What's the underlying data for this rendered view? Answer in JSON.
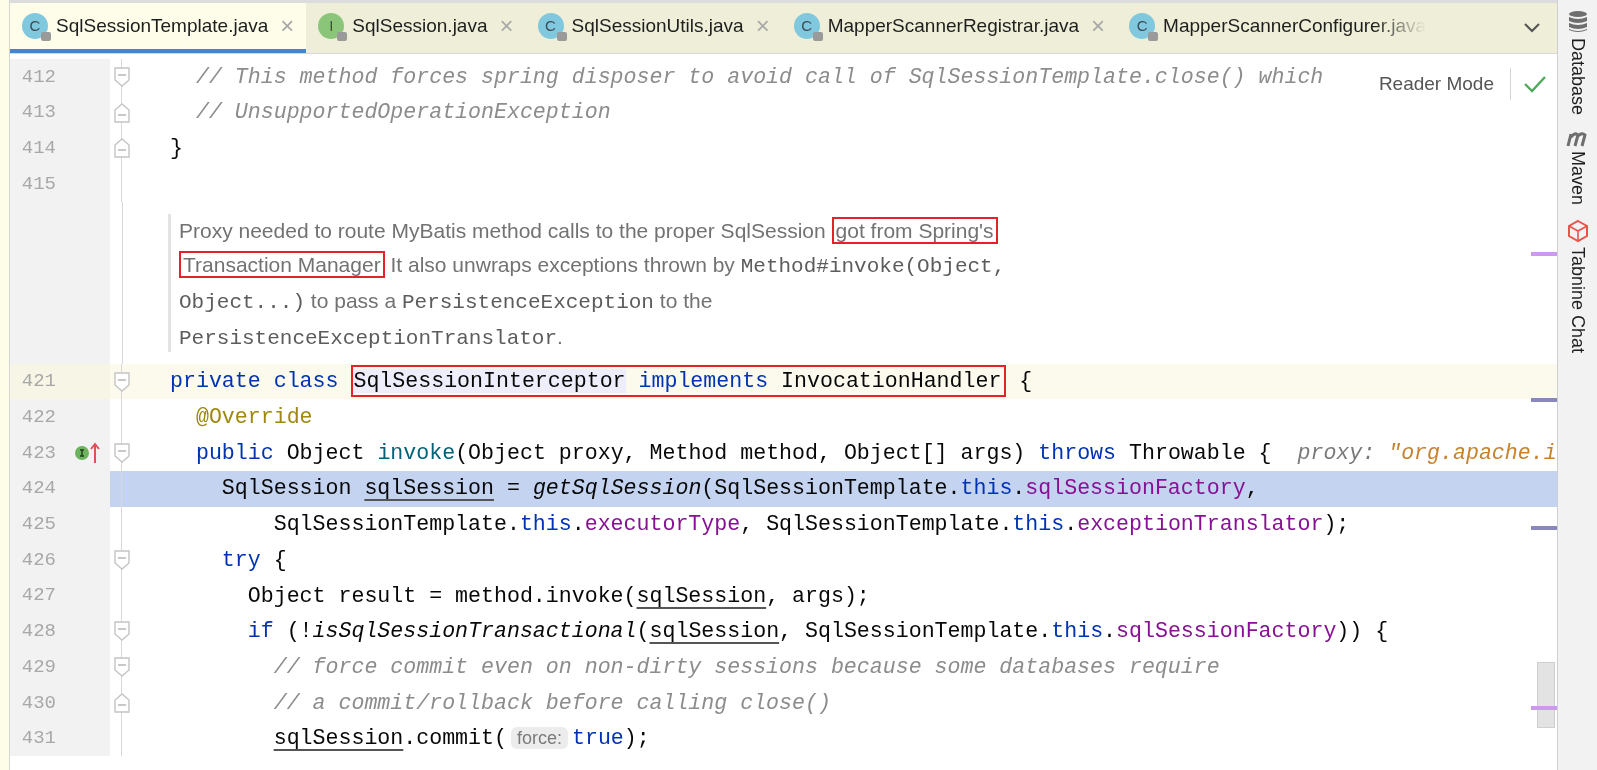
{
  "tabs": [
    {
      "label": "SqlSessionTemplate.java",
      "icon_letter": "C",
      "interface": false,
      "locked": true,
      "close": "×",
      "faded": false,
      "selected": true
    },
    {
      "label": "SqlSession.java",
      "icon_letter": "I",
      "interface": true,
      "locked": true,
      "close": "×",
      "faded": false,
      "selected": false
    },
    {
      "label": "SqlSessionUtils.java",
      "icon_letter": "C",
      "interface": false,
      "locked": true,
      "close": "×",
      "faded": false,
      "selected": false
    },
    {
      "label": "MapperScannerRegistrar.java",
      "icon_letter": "C",
      "interface": false,
      "locked": true,
      "close": "×",
      "faded": false,
      "selected": false
    },
    {
      "label": "MapperScannerConfigurer.java",
      "icon_letter": "C",
      "interface": false,
      "locked": true,
      "faded": true,
      "selected": false
    }
  ],
  "editor": {
    "reader_mode": "Reader Mode",
    "lines": [
      {
        "kind": "code",
        "number": "412",
        "fold_start": true,
        "fold_end": false,
        "implements_marker": false,
        "caret": false,
        "selected": false,
        "tokens": [
          {
            "t": "  // This method forces spring disposer to avoid call of SqlSessionTemplate.close() which",
            "kind": "comment"
          }
        ]
      },
      {
        "kind": "code",
        "number": "413",
        "fold_start": false,
        "fold_end": true,
        "implements_marker": false,
        "caret": false,
        "selected": false,
        "tokens": [
          {
            "t": "  // UnsupportedOperationException",
            "kind": "comment"
          }
        ]
      },
      {
        "kind": "code",
        "number": "414",
        "fold_start": false,
        "fold_end": true,
        "implements_marker": false,
        "caret": false,
        "selected": false,
        "tokens": [
          {
            "t": "}",
            "kind": "plain"
          }
        ]
      },
      {
        "kind": "code",
        "number": "415",
        "fold_start": false,
        "fold_end": false,
        "implements_marker": false,
        "caret": false,
        "selected": false
      },
      {
        "kind": "doc",
        "lines": [
          [
            {
              "t": "Proxy needed to route MyBatis method calls to the proper SqlSession ",
              "kind": "text",
              "box": false
            },
            {
              "t": "got from Spring's",
              "kind": "text",
              "box": true
            }
          ],
          [
            {
              "t": "Transaction Manager",
              "kind": "text",
              "box": true
            },
            {
              "t": " It also unwraps exceptions thrown by ",
              "kind": "text",
              "box": false
            },
            {
              "t": "Method#invoke(Object,",
              "kind": "code",
              "box": false
            }
          ],
          [
            {
              "t": "Object...)",
              "kind": "code",
              "box": false
            },
            {
              "t": " to pass a ",
              "kind": "text",
              "box": false
            },
            {
              "t": "PersistenceException",
              "kind": "code",
              "box": false
            },
            {
              "t": " to the",
              "kind": "text",
              "box": false
            }
          ],
          [
            {
              "t": "PersistenceExceptionTranslator",
              "kind": "code",
              "box": false
            },
            {
              "t": ".",
              "kind": "text",
              "box": false
            }
          ]
        ]
      },
      {
        "kind": "code",
        "number": "421",
        "fold_start": true,
        "fold_end": false,
        "implements_marker": false,
        "caret": true,
        "selected": false,
        "tokens": [
          {
            "t": "private class ",
            "kind": "keyword"
          },
          {
            "box": [
              {
                "t": "SqlSessionInterceptor",
                "kind": "usage"
              },
              {
                "t": " implements",
                "kind": "keyword"
              },
              {
                "t": " InvocationHandler",
                "kind": "plain"
              }
            ]
          },
          {
            "t": " {",
            "kind": "plain"
          }
        ]
      },
      {
        "kind": "code",
        "number": "422",
        "fold_start": false,
        "fold_end": false,
        "implements_marker": false,
        "caret": false,
        "selected": false,
        "tokens": [
          {
            "t": "  @Override",
            "kind": "annotation"
          }
        ]
      },
      {
        "kind": "code",
        "number": "423",
        "fold_start": true,
        "fold_end": false,
        "implements_marker": true,
        "caret": false,
        "selected": false,
        "tokens": [
          {
            "t": "  public",
            "kind": "keyword"
          },
          {
            "t": " Object ",
            "kind": "plain"
          },
          {
            "t": "invoke",
            "kind": "method"
          },
          {
            "t": "(Object proxy, Method method, Object[] args) ",
            "kind": "plain"
          },
          {
            "t": "throws",
            "kind": "keyword"
          },
          {
            "t": " Throwable {  ",
            "kind": "plain"
          },
          {
            "t": "proxy: ",
            "kind": "hint"
          },
          {
            "t": "\"org.apache.i",
            "kind": "string"
          }
        ]
      },
      {
        "kind": "code",
        "number": "424",
        "fold_start": false,
        "fold_end": false,
        "implements_marker": false,
        "caret": false,
        "selected": true,
        "tokens": [
          {
            "t": "    SqlSession ",
            "kind": "plain"
          },
          {
            "t": "sqlSession",
            "kind": "variable"
          },
          {
            "t": " = ",
            "kind": "plain"
          },
          {
            "t": "getSqlSession",
            "kind": "static"
          },
          {
            "t": "(SqlSessionTemplate.",
            "kind": "plain"
          },
          {
            "t": "this",
            "kind": "keyword"
          },
          {
            "t": ".",
            "kind": "plain"
          },
          {
            "t": "sqlSessionFactory",
            "kind": "field"
          },
          {
            "t": ",",
            "kind": "plain"
          }
        ]
      },
      {
        "kind": "code",
        "number": "425",
        "fold_start": false,
        "fold_end": false,
        "implements_marker": false,
        "caret": false,
        "selected": false,
        "tokens": [
          {
            "t": "        SqlSessionTemplate.",
            "kind": "plain"
          },
          {
            "t": "this",
            "kind": "keyword"
          },
          {
            "t": ".",
            "kind": "plain"
          },
          {
            "t": "executorType",
            "kind": "field"
          },
          {
            "t": ", SqlSessionTemplate.",
            "kind": "plain"
          },
          {
            "t": "this",
            "kind": "keyword"
          },
          {
            "t": ".",
            "kind": "plain"
          },
          {
            "t": "exceptionTranslator",
            "kind": "field"
          },
          {
            "t": ");",
            "kind": "plain"
          }
        ]
      },
      {
        "kind": "code",
        "number": "426",
        "fold_start": true,
        "fold_end": false,
        "implements_marker": false,
        "caret": false,
        "selected": false,
        "tokens": [
          {
            "t": "    try",
            "kind": "keyword"
          },
          {
            "t": " {",
            "kind": "plain"
          }
        ]
      },
      {
        "kind": "code",
        "number": "427",
        "fold_start": false,
        "fold_end": false,
        "implements_marker": false,
        "caret": false,
        "selected": false,
        "tokens": [
          {
            "t": "      Object result = method.invoke(",
            "kind": "plain"
          },
          {
            "t": "sqlSession",
            "kind": "variable"
          },
          {
            "t": ", args);",
            "kind": "plain"
          }
        ]
      },
      {
        "kind": "code",
        "number": "428",
        "fold_start": true,
        "fold_end": false,
        "implements_marker": false,
        "caret": false,
        "selected": false,
        "tokens": [
          {
            "t": "      if",
            "kind": "keyword"
          },
          {
            "t": " (!",
            "kind": "plain"
          },
          {
            "t": "isSqlSessionTransactional",
            "kind": "static"
          },
          {
            "t": "(",
            "kind": "plain"
          },
          {
            "t": "sqlSession",
            "kind": "variable"
          },
          {
            "t": ", SqlSessionTemplate.",
            "kind": "plain"
          },
          {
            "t": "this",
            "kind": "keyword"
          },
          {
            "t": ".",
            "kind": "plain"
          },
          {
            "t": "sqlSessionFactory",
            "kind": "field"
          },
          {
            "t": ")) {",
            "kind": "plain"
          }
        ]
      },
      {
        "kind": "code",
        "number": "429",
        "fold_start": true,
        "fold_end": false,
        "implements_marker": false,
        "caret": false,
        "selected": false,
        "tokens": [
          {
            "t": "        // force commit even on non-dirty sessions because some databases require",
            "kind": "comment"
          }
        ]
      },
      {
        "kind": "code",
        "number": "430",
        "fold_start": false,
        "fold_end": true,
        "implements_marker": false,
        "caret": false,
        "selected": false,
        "tokens": [
          {
            "t": "        // a commit/rollback before calling close()",
            "kind": "comment"
          }
        ]
      },
      {
        "kind": "code",
        "number": "431",
        "fold_start": false,
        "fold_end": false,
        "implements_marker": false,
        "caret": false,
        "selected": false,
        "tokens": [
          {
            "t": "        sqlSession",
            "kind": "variable"
          },
          {
            "t": ".commit(",
            "kind": "plain"
          },
          {
            "t": "force:",
            "kind": "chip"
          },
          {
            "t": "true",
            "kind": "keyword"
          },
          {
            "t": ");",
            "kind": "plain"
          }
        ]
      }
    ]
  },
  "tool_windows": [
    {
      "label": "Database"
    },
    {
      "label": "Maven"
    },
    {
      "label": "Tabnine Chat"
    }
  ]
}
